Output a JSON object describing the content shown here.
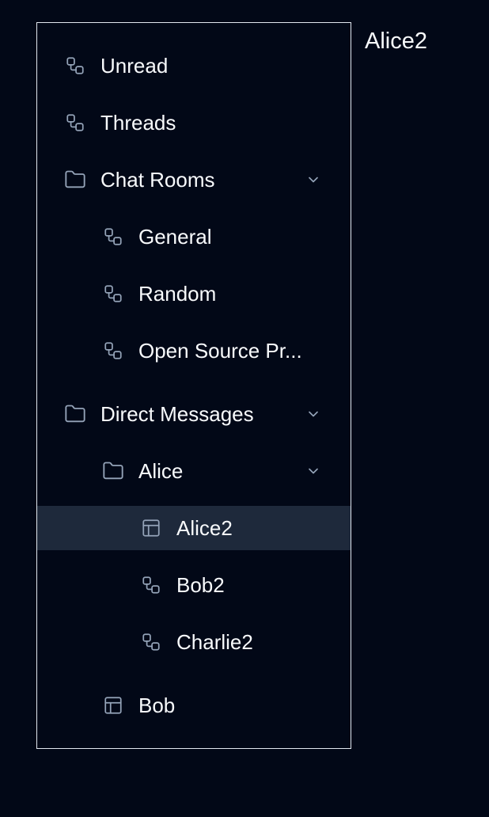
{
  "header": {
    "title": "Alice2"
  },
  "sidebar": {
    "items": [
      {
        "label": "Unread",
        "icon": "workflow-icon"
      },
      {
        "label": "Threads",
        "icon": "workflow-icon"
      },
      {
        "label": "Chat Rooms",
        "icon": "folder-icon",
        "expanded": true
      },
      {
        "label": "General",
        "icon": "workflow-icon"
      },
      {
        "label": "Random",
        "icon": "workflow-icon"
      },
      {
        "label": "Open Source Pr...",
        "icon": "workflow-icon"
      },
      {
        "label": "Direct Messages",
        "icon": "folder-icon",
        "expanded": true
      },
      {
        "label": "Alice",
        "icon": "folder-icon",
        "expanded": true
      },
      {
        "label": "Alice2",
        "icon": "layout-icon",
        "selected": true
      },
      {
        "label": "Bob2",
        "icon": "workflow-icon"
      },
      {
        "label": "Charlie2",
        "icon": "workflow-icon"
      },
      {
        "label": "Bob",
        "icon": "layout-icon"
      }
    ]
  },
  "colors": {
    "background": "#020817",
    "selected": "#1e293b",
    "border": "#e2e8f0",
    "icon": "#94a3b8",
    "text": "#f8fafc"
  }
}
